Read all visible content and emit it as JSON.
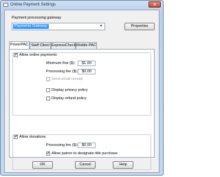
{
  "window": {
    "title": "Online Payment Settings",
    "close_glyph": "✕"
  },
  "gateway": {
    "label": "Payment processing gateway",
    "selected": "Payments Gateway",
    "properties_label": "Properties"
  },
  "tabs": [
    {
      "label": "PowerPAC",
      "active": true
    },
    {
      "label": "Staff Client",
      "active": false
    },
    {
      "label": "ExpressCheck",
      "active": false
    },
    {
      "label": "Mobile PAC",
      "active": false
    }
  ],
  "powerpac": {
    "allow_online_payments": {
      "label": "Allow online payments",
      "checked": true
    },
    "minimum_fine": {
      "label": "Minimum fine ($):",
      "value": "$1.00"
    },
    "processing_fee": {
      "label": "Processing fee ($):",
      "value": "$0.00"
    },
    "send_email_receipt": {
      "label": "Send email receipt",
      "checked": false
    },
    "display_privacy_policy": {
      "label": "Display privacy policy",
      "checked": false
    },
    "display_refund_policy": {
      "label": "Display refund policy",
      "checked": false
    },
    "allow_donations": {
      "label": "Allow donations",
      "checked": true
    },
    "donation_processing_fee": {
      "label": "Processing fee ($):",
      "value": "$0.00"
    },
    "designate_title": {
      "label": "Allow patron to designate title purchase",
      "checked": true
    }
  },
  "footer": {
    "ok_label": "OK",
    "cancel_label": "Cancel",
    "help_label": "Help"
  },
  "glyphs": {
    "check": "✔",
    "dropdown": "▼"
  }
}
